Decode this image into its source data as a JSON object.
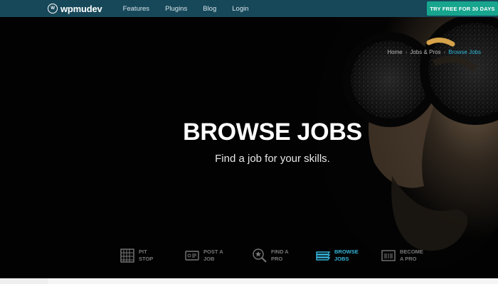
{
  "brand": {
    "name": "wpmudev",
    "icon": "wpmudev-logo-icon"
  },
  "nav": {
    "features": "Features",
    "plugins": "Plugins",
    "blog": "Blog",
    "login": "Login"
  },
  "cta": {
    "label": "TRY FREE FOR 30 DAYS",
    "color": "#17a58e"
  },
  "breadcrumb": {
    "home": "Home",
    "jobs_pros": "Jobs & Pros",
    "current": "Browse Jobs"
  },
  "hero": {
    "title": "BROWSE JOBS",
    "subtitle": "Find a job for your skills."
  },
  "job_nav": {
    "items": [
      {
        "label": "PIT\nSTOP",
        "icon": "pit-stop-icon"
      },
      {
        "label": "POST A\nJOB",
        "icon": "post-job-icon"
      },
      {
        "label": "FIND A\nPRO",
        "icon": "find-pro-icon"
      },
      {
        "label": "BROWSE\nJOBS",
        "icon": "browse-jobs-icon",
        "active": true
      },
      {
        "label": "BECOME\nA PRO",
        "icon": "become-pro-icon"
      }
    ]
  },
  "colors": {
    "header_bg": "#17485a",
    "accent_blue": "#36b5d9",
    "inactive_gray": "#777777"
  }
}
